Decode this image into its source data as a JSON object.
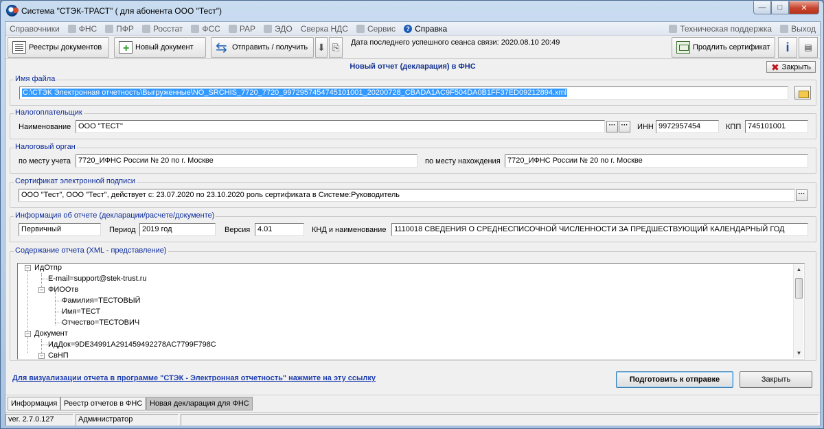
{
  "window": {
    "title": "Система \"СТЭК-ТРАСТ\" ( для абонента ООО \"Тест\")",
    "minimize": "—",
    "maximize": "□",
    "close": "✕"
  },
  "menu": {
    "items": [
      {
        "label": "Справочники",
        "icon": "book-icon"
      },
      {
        "label": "ФНС",
        "icon": "fns-icon"
      },
      {
        "label": "ПФР",
        "icon": "pfr-icon"
      },
      {
        "label": "Росстат",
        "icon": "rosstat-icon"
      },
      {
        "label": "ФСС",
        "icon": "fss-icon"
      },
      {
        "label": "РАР",
        "icon": "rar-icon"
      },
      {
        "label": "ЭДО",
        "icon": "edo-icon"
      },
      {
        "label": "Сверка НДС",
        "icon": ""
      },
      {
        "label": "Сервис",
        "icon": "gear-icon"
      },
      {
        "label": "Справка",
        "icon": "help-icon"
      }
    ],
    "support": "Техническая поддержка",
    "exit": "Выход"
  },
  "toolbar": {
    "registry": "Реестры документов",
    "new_doc": "Новый документ",
    "send_receive": "Отправить / получить",
    "last_session": "Дата последнего успешного сеанса связи: 2020.08.10 20:49",
    "extend_cert": "Продлить сертификат"
  },
  "form": {
    "title": "Новый отчет (декларация) в ФНС",
    "close_top": "Закрыть",
    "file_group": "Имя файла",
    "file_path": "C:\\СТЭК Электронная отчетность\\Выгруженные\\NO_SRCHIS_7720_7720_9972957454745101001_20200728_CBADA1AC9F504DA0B1FF37ED09212894.xml",
    "taxpayer_group": "Налогоплательщик",
    "name_label": "Наименование",
    "name_value": "ООО \"ТЕСТ\"",
    "inn_label": "ИНН",
    "inn_value": "9972957454",
    "kpp_label": "КПП",
    "kpp_value": "745101001",
    "tax_org_group": "Налоговый орган",
    "by_account_label": "по месту учета",
    "by_account_value": "7720_ИФНС России № 20 по г. Москве",
    "by_location_label": "по месту нахождения",
    "by_location_value": "7720_ИФНС России № 20 по г. Москве",
    "cert_group": "Сертификат электронной подписи",
    "cert_value": "ООО \"Тест\", ООО \"Тест\", действует с: 23.07.2020 по 23.10.2020 роль сертификата в Системе:Руководитель",
    "report_group": "Информация об отчете (декларации/расчете/документе)",
    "report_type": "Первичный",
    "period_label": "Период",
    "period_value": "2019 год",
    "version_label": "Версия",
    "version_value": "4.01",
    "knd_label": "КНД и наименование",
    "knd_value": "1110018 СВЕДЕНИЯ О СРЕДНЕСПИСОЧНОЙ ЧИСЛЕННОСТИ ЗА ПРЕДШЕСТВУЮЩИЙ КАЛЕНДАРНЫЙ ГОД",
    "xml_group": "Содержание отчета (XML - представление)",
    "tree": [
      {
        "text": "ИдОтпр",
        "level": 0,
        "toggle": "−"
      },
      {
        "text": "E-mail=support@stek-trust.ru",
        "level": 1,
        "toggle": ""
      },
      {
        "text": "ФИООтв",
        "level": 1,
        "toggle": "−"
      },
      {
        "text": "Фамилия=ТЕСТОВЫЙ",
        "level": 2,
        "toggle": ""
      },
      {
        "text": "Имя=ТЕСТ",
        "level": 2,
        "toggle": ""
      },
      {
        "text": "Отчество=ТЕСТОВИЧ",
        "level": 2,
        "toggle": ""
      },
      {
        "text": "Документ",
        "level": 0,
        "toggle": "−"
      },
      {
        "text": "ИдДок=9DE34991A291459492278AC7799F798C",
        "level": 1,
        "toggle": ""
      },
      {
        "text": "СвНП",
        "level": 1,
        "toggle": "−"
      }
    ],
    "visualize_link": "Для визуализации отчета в программе \"СТЭК - Электронная отчетность\" нажмите на эту ссылку",
    "prepare_button": "Подготовить к отправке",
    "close_button": "Закрыть"
  },
  "tabs": [
    "Информация",
    "Реестр отчетов в ФНС",
    "Новая декларация для ФНС"
  ],
  "status": {
    "version": "ver. 2.7.0.127",
    "user": "Администратор"
  }
}
